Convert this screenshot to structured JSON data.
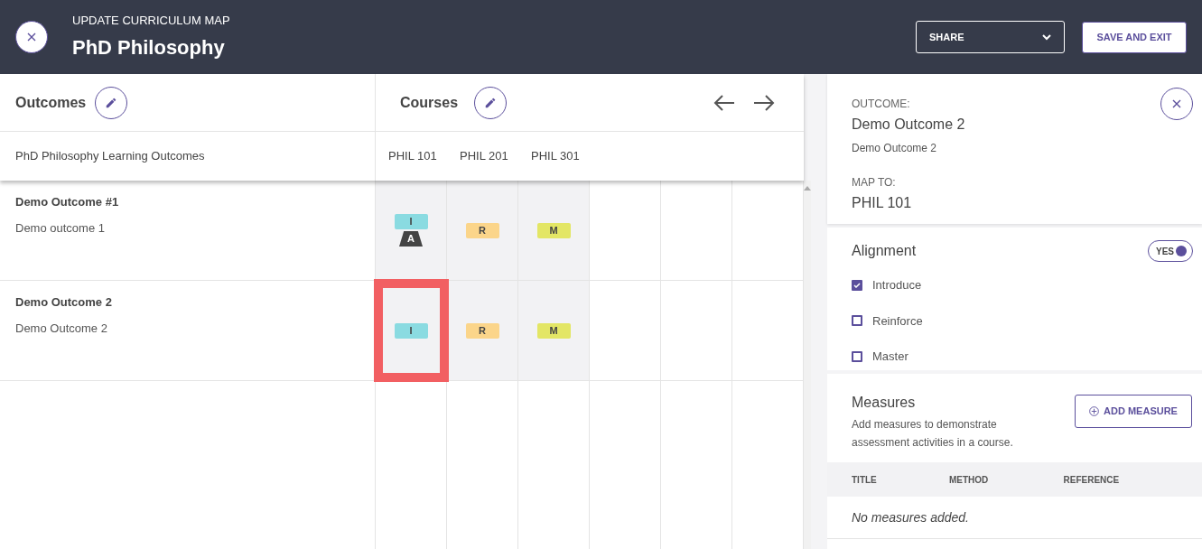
{
  "header": {
    "subtitle": "UPDATE CURRICULUM MAP",
    "title": "PhD Philosophy",
    "share": "SHARE",
    "save": "SAVE AND EXIT"
  },
  "map": {
    "outcomes_heading": "Outcomes",
    "courses_heading": "Courses",
    "outcomes_label": "PhD Philosophy Learning Outcomes",
    "courses": [
      "PHIL 101",
      "PHIL 201",
      "PHIL 301"
    ],
    "rows": [
      {
        "title": "Demo Outcome #1",
        "description": "Demo outcome 1",
        "cells": [
          {
            "code": "I",
            "color": "#8adbe1",
            "assessment": "A",
            "selected": false
          },
          {
            "code": "R",
            "color": "#fbd58a",
            "selected": false
          },
          {
            "code": "M",
            "color": "#e3e665",
            "selected": false
          }
        ]
      },
      {
        "title": "Demo Outcome 2",
        "description": "Demo Outcome 2",
        "cells": [
          {
            "code": "I",
            "color": "#8adbe1",
            "selected": true
          },
          {
            "code": "R",
            "color": "#fbd58a",
            "selected": false
          },
          {
            "code": "M",
            "color": "#e3e665",
            "selected": false
          }
        ]
      }
    ]
  },
  "panel": {
    "outcome_label": "OUTCOME:",
    "outcome_title": "Demo Outcome 2",
    "outcome_description": "Demo Outcome 2",
    "map_label": "MAP TO:",
    "map_value": "PHIL 101",
    "alignment": {
      "heading": "Alignment",
      "toggle": {
        "label": "YES",
        "on": true
      },
      "options": [
        {
          "label": "Introduce",
          "checked": true
        },
        {
          "label": "Reinforce",
          "checked": false
        },
        {
          "label": "Master",
          "checked": false
        }
      ]
    },
    "measures": {
      "heading": "Measures",
      "description": "Add measures to demonstrate assessment activities in a course.",
      "button": "ADD MEASURE",
      "columns": [
        "TITLE",
        "METHOD",
        "REFERENCE"
      ],
      "empty": "No measures added."
    }
  }
}
